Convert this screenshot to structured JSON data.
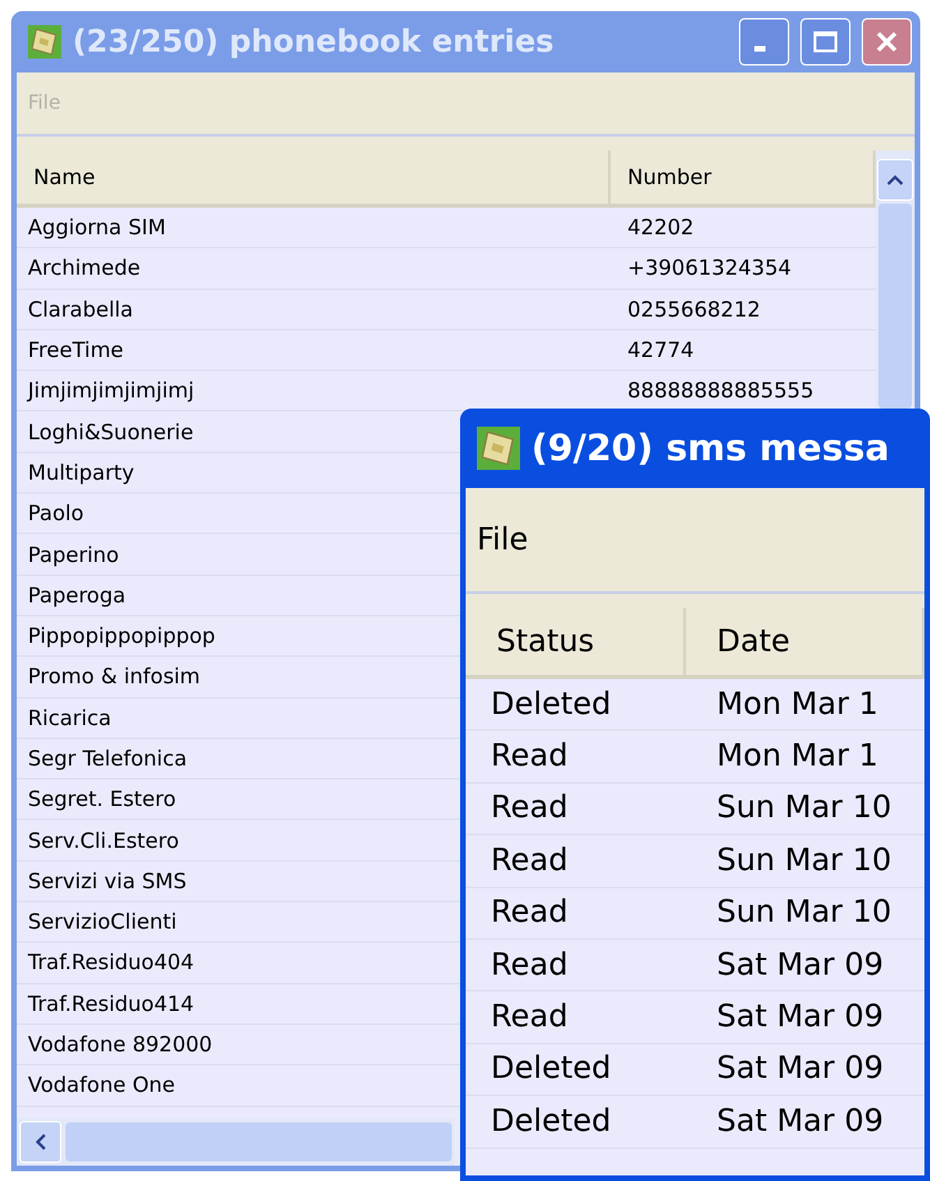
{
  "windows": [
    {
      "kind": "phonebook",
      "title": "(23/250) phonebook entries",
      "active": false,
      "menu": [
        {
          "label": "File",
          "disabled": true
        }
      ],
      "columns": [
        "Name",
        "Number"
      ],
      "rows": [
        {
          "cells": [
            "Aggiorna SIM",
            "42202"
          ]
        },
        {
          "cells": [
            "Archimede",
            "+39061324354"
          ]
        },
        {
          "cells": [
            "Clarabella",
            "0255668212"
          ]
        },
        {
          "cells": [
            "FreeTime",
            "42774"
          ]
        },
        {
          "cells": [
            "Jimjimjimjimjimj",
            "88888888885555"
          ]
        },
        {
          "cells": [
            "Loghi&Suonerie"
          ]
        },
        {
          "cells": [
            "Multiparty"
          ]
        },
        {
          "cells": [
            "Paolo"
          ]
        },
        {
          "cells": [
            "Paperino"
          ]
        },
        {
          "cells": [
            "Paperoga"
          ]
        },
        {
          "cells": [
            "Pippopippopippop"
          ]
        },
        {
          "cells": [
            "Promo & infosim"
          ]
        },
        {
          "cells": [
            "Ricarica"
          ]
        },
        {
          "cells": [
            "Segr Telefonica"
          ]
        },
        {
          "cells": [
            "Segret. Estero"
          ]
        },
        {
          "cells": [
            "Serv.Cli.Estero"
          ]
        },
        {
          "cells": [
            "Servizi via SMS"
          ]
        },
        {
          "cells": [
            "ServizioClienti"
          ]
        },
        {
          "cells": [
            "Traf.Residuo404"
          ]
        },
        {
          "cells": [
            "Traf.Residuo414"
          ]
        },
        {
          "cells": [
            "Vodafone 892000"
          ]
        },
        {
          "cells": [
            "Vodafone One"
          ]
        }
      ]
    },
    {
      "kind": "sms",
      "title": "(9/20) sms messa",
      "active": true,
      "menu": [
        {
          "label": "File",
          "disabled": false
        }
      ],
      "columns": [
        "Status",
        "Date"
      ],
      "rows": [
        {
          "cells": [
            "Deleted",
            "Mon Mar 1"
          ]
        },
        {
          "cells": [
            "Read",
            "Mon Mar 1"
          ]
        },
        {
          "cells": [
            "Read",
            "Sun Mar 10"
          ]
        },
        {
          "cells": [
            "Read",
            "Sun Mar 10"
          ]
        },
        {
          "cells": [
            "Read",
            "Sun Mar 10"
          ]
        },
        {
          "cells": [
            "Read",
            "Sat Mar 09"
          ]
        },
        {
          "cells": [
            "Read",
            "Sat Mar 09"
          ]
        },
        {
          "cells": [
            "Deleted",
            "Sat Mar 09"
          ]
        },
        {
          "cells": [
            "Deleted",
            "Sat Mar 09"
          ]
        }
      ]
    }
  ]
}
